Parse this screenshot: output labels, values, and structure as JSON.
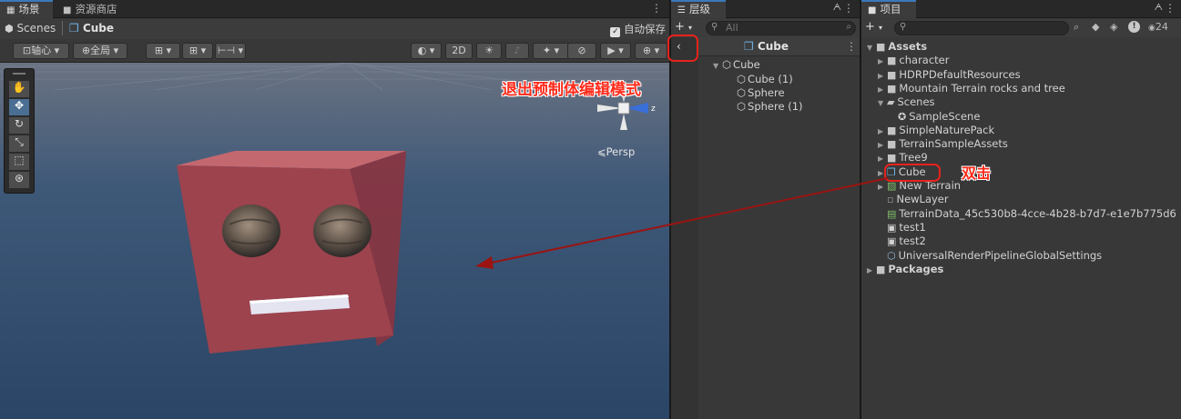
{
  "scene": {
    "tabs": [
      {
        "label": "场景",
        "icon": "grid-icon"
      },
      {
        "label": "资源商店",
        "icon": "store-icon"
      }
    ],
    "breadcrumb": {
      "scenes": "Scenes",
      "prefab": "Cube"
    },
    "autosave_label": "自动保存",
    "autosave_checked": true,
    "toolbar": {
      "pivot": "轴心",
      "global": "全局",
      "mode_2d": "2D"
    },
    "gizmo_axis": "z",
    "persp_label": "Persp"
  },
  "hierarchy": {
    "tab": "层级",
    "search_placeholder": "All",
    "prefab_title": "Cube",
    "items": [
      {
        "label": "Cube",
        "depth": 0,
        "expanded": true
      },
      {
        "label": "Cube (1)",
        "depth": 1
      },
      {
        "label": "Sphere",
        "depth": 1
      },
      {
        "label": "Sphere (1)",
        "depth": 1
      }
    ]
  },
  "project": {
    "tab": "项目",
    "visible_count": "24",
    "items": [
      {
        "label": "Assets",
        "type": "folder",
        "depth": 0,
        "expanded": true,
        "bold": true
      },
      {
        "label": "character",
        "type": "folder",
        "depth": 1
      },
      {
        "label": "HDRPDefaultResources",
        "type": "folder",
        "depth": 1
      },
      {
        "label": "Mountain Terrain rocks and tree",
        "type": "folder",
        "depth": 1
      },
      {
        "label": "Scenes",
        "type": "folder-open",
        "depth": 1,
        "expanded": true
      },
      {
        "label": "SampleScene",
        "type": "scene",
        "depth": 2
      },
      {
        "label": "SimpleNaturePack",
        "type": "folder",
        "depth": 1
      },
      {
        "label": "TerrainSampleAssets",
        "type": "folder",
        "depth": 1
      },
      {
        "label": "Tree9",
        "type": "folder",
        "depth": 1
      },
      {
        "label": "Cube",
        "type": "prefab",
        "depth": 1
      },
      {
        "label": "New Terrain",
        "type": "terrain",
        "depth": 1
      },
      {
        "label": "NewLayer",
        "type": "layer",
        "depth": 1
      },
      {
        "label": "TerrainData_45c530b8-4cce-4b28-b7d7-e1e7b775d6",
        "type": "terrain-data",
        "depth": 1
      },
      {
        "label": "test1",
        "type": "script",
        "depth": 1
      },
      {
        "label": "test2",
        "type": "script",
        "depth": 1
      },
      {
        "label": "UniversalRenderPipelineGlobalSettings",
        "type": "settings",
        "depth": 1
      },
      {
        "label": "Packages",
        "type": "folder",
        "depth": 0,
        "bold": true
      }
    ]
  },
  "annotations": {
    "exit_prefab": "退出预制体编辑模式",
    "double_click": "双击",
    "color": "#e8231c"
  },
  "colors": {
    "viewport_bg": "#2e4a6b",
    "cube_face": "#9c434e",
    "accent": "#3a79bb"
  }
}
